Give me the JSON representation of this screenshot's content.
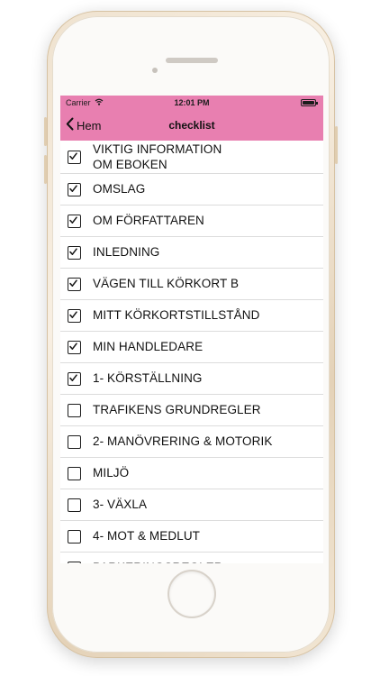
{
  "status_bar": {
    "carrier": "Carrier",
    "time": "12:01 PM"
  },
  "nav": {
    "back_label": "Hem",
    "title": "checklist"
  },
  "colors": {
    "accent": "#e87fb0",
    "divider": "#dcdcdc"
  },
  "items": [
    {
      "label": "VIKTIG INFORMATION\nOM EBOKEN",
      "checked": true
    },
    {
      "label": "OMSLAG",
      "checked": true
    },
    {
      "label": "OM FÖRFATTAREN",
      "checked": true
    },
    {
      "label": "INLEDNING",
      "checked": true
    },
    {
      "label": "VÄGEN TILL KÖRKORT B",
      "checked": true
    },
    {
      "label": "MITT KÖRKORTSTILLSTÅND",
      "checked": true
    },
    {
      "label": "MIN HANDLEDARE",
      "checked": true
    },
    {
      "label": "1- KÖRSTÄLLNING",
      "checked": true
    },
    {
      "label": "TRAFIKENS GRUNDREGLER",
      "checked": false
    },
    {
      "label": "2- MANÖVRERING & MOTORIK",
      "checked": false
    },
    {
      "label": "MILJÖ",
      "checked": false
    },
    {
      "label": "3- VÄXLA",
      "checked": false
    },
    {
      "label": "4- MOT & MEDLUT",
      "checked": false
    },
    {
      "label": "PARKERINGSREGLER",
      "checked": false
    }
  ]
}
